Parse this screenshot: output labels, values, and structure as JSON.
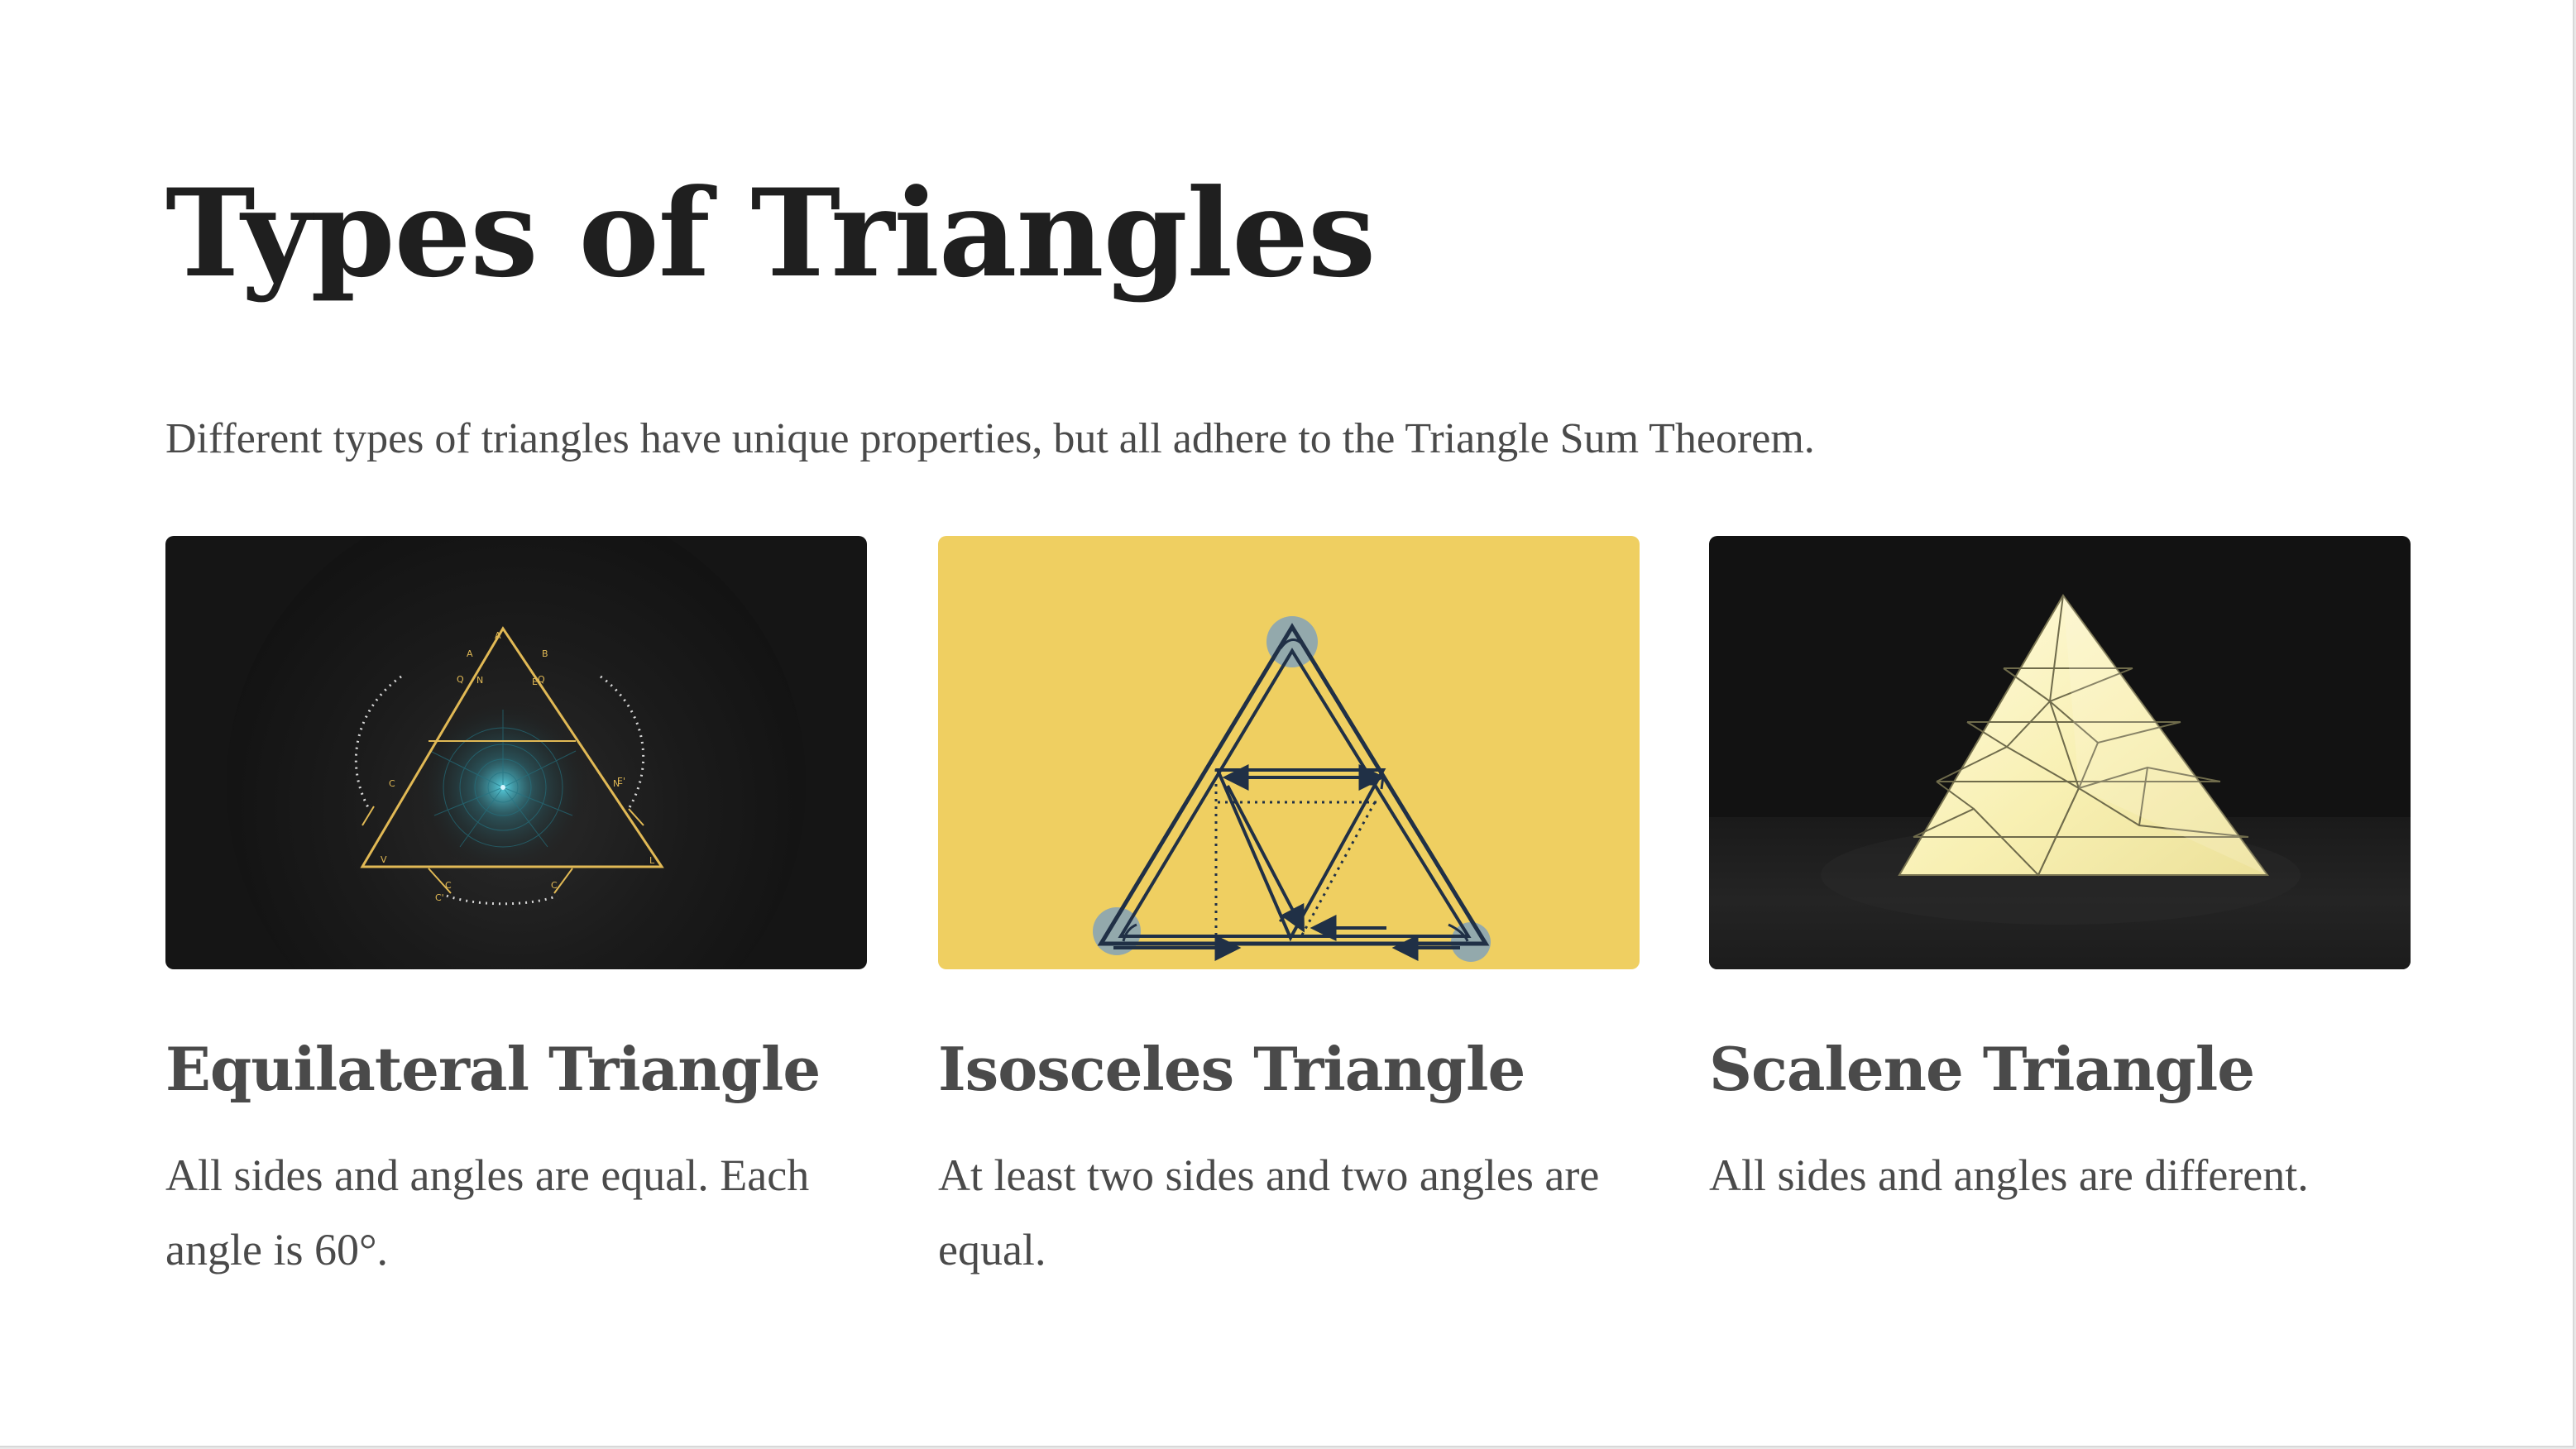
{
  "page": {
    "title": "Types of Triangles",
    "subtitle": "Different types of triangles have unique properties, but all adhere to the Triangle Sum Theorem."
  },
  "cards": [
    {
      "heading": "Equilateral Triangle",
      "body": "All sides and angles are equal. Each angle is 60°.",
      "image": "equilateral-triangle-diagram",
      "image_background": "#151515",
      "accent": "#e1b955"
    },
    {
      "heading": "Isosceles Triangle",
      "body": "At least two sides and two angles are equal.",
      "image": "isosceles-triangle-diagram",
      "image_background": "#efcf61",
      "accent": "#203046"
    },
    {
      "heading": "Scalene Triangle",
      "body": "All sides and angles are different.",
      "image": "scalene-triangle-pyramid",
      "image_background": "#121212",
      "accent": "#f7f1b8"
    }
  ],
  "colors": {
    "title": "#1f1f1f",
    "text": "#4a4a4a",
    "background": "#ffffff"
  }
}
